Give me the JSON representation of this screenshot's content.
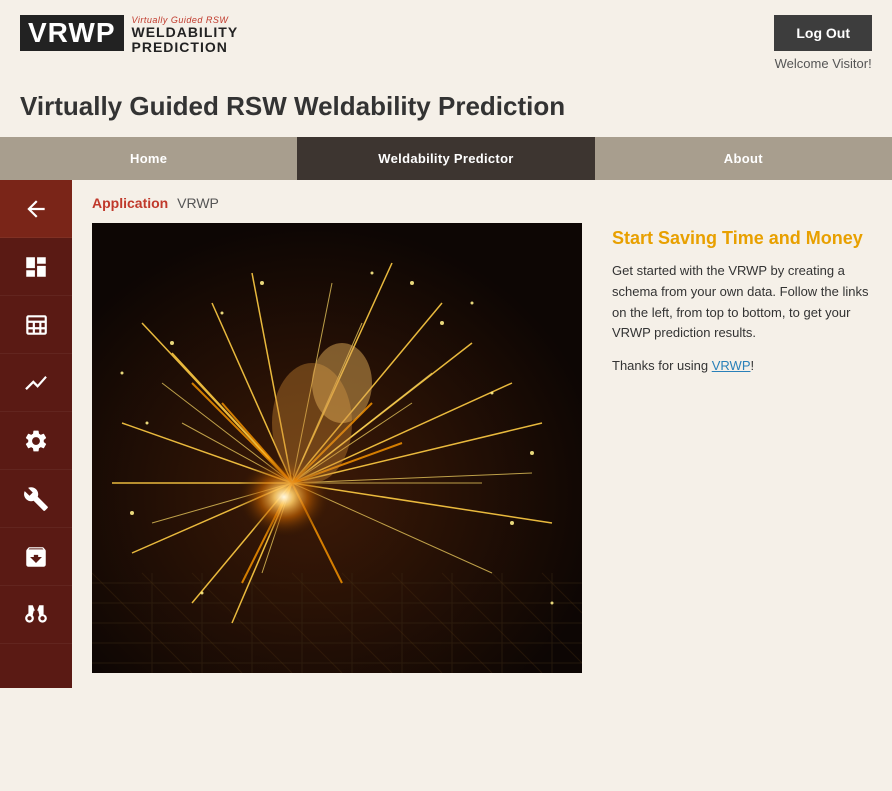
{
  "logo": {
    "acronym": "VRWP",
    "line1": "Virtually Guided RSW",
    "line2": "WELDABILITY",
    "line3": "PREDICTION"
  },
  "header": {
    "logout_label": "Log Out",
    "welcome_text": "Welcome Visitor!"
  },
  "page_title": "Virtually Guided RSW Weldability Prediction",
  "nav": {
    "items": [
      {
        "label": "Home",
        "key": "home"
      },
      {
        "label": "Weldability Predictor",
        "key": "predictor"
      },
      {
        "label": "About",
        "key": "about"
      }
    ]
  },
  "sidebar": {
    "items": [
      {
        "icon": "arrow",
        "label": "Back",
        "name": "back-icon"
      },
      {
        "icon": "dashboard",
        "label": "Dashboard",
        "name": "dashboard-icon"
      },
      {
        "icon": "table",
        "label": "Table",
        "name": "table-icon"
      },
      {
        "icon": "chart",
        "label": "Chart",
        "name": "chart-icon"
      },
      {
        "icon": "settings",
        "label": "Settings",
        "name": "settings-icon"
      },
      {
        "icon": "wrench",
        "label": "Wrench",
        "name": "wrench-icon"
      },
      {
        "icon": "cube",
        "label": "Cube",
        "name": "cube-icon"
      },
      {
        "icon": "binoculars",
        "label": "Binoculars",
        "name": "binoculars-icon"
      }
    ]
  },
  "breadcrumb": {
    "app_label": "Application",
    "app_name": "VRWP"
  },
  "main_content": {
    "heading": "Start Saving Time and Money",
    "paragraph1": "Get started with the VRWP by creating a schema from your own data. Follow the links on the left, from top to bottom, to get your VRWP prediction results.",
    "paragraph2": "Thanks for using VRWP!"
  },
  "colors": {
    "brand_red": "#c0392b",
    "dark_nav": "#3d3530",
    "tan_nav": "#a89e8e",
    "sidebar_bg": "#5a1a14",
    "gold": "#e8a000",
    "link_blue": "#2980b9"
  }
}
